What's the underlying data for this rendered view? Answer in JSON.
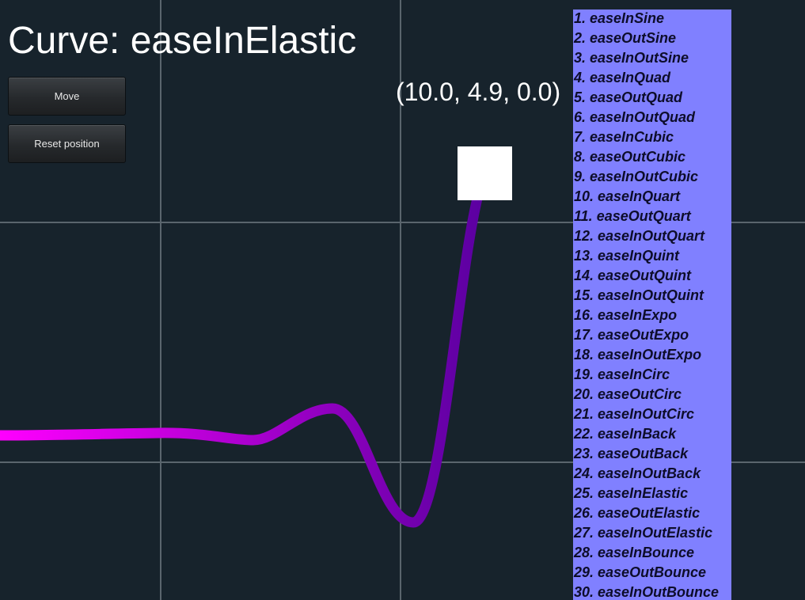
{
  "title": "Curve: easeInElastic",
  "buttons": {
    "move_label": "Move",
    "reset_label": "Reset position"
  },
  "position_readout": "(10.0, 4.9, 0.0)",
  "curve_list": [
    "1. easeInSine",
    "2. easeOutSine",
    "3. easeInOutSine",
    "4. easeInQuad",
    "5. easeOutQuad",
    "6. easeInOutQuad",
    "7. easeInCubic",
    "8. easeOutCubic",
    "9. easeInOutCubic",
    "10. easeInQuart",
    "11. easeOutQuart",
    "12. easeInOutQuart",
    "13. easeInQuint",
    "14. easeOutQuint",
    "15. easeInOutQuint",
    "16. easeInExpo",
    "17. easeOutExpo",
    "18. easeInOutExpo",
    "19. easeInCirc",
    "20. easeOutCirc",
    "21. easeInOutCirc",
    "22. easeInBack",
    "23. easeOutBack",
    "24. easeInOutBack",
    "25. easeInElastic",
    "26. easeOutElastic",
    "27. easeInOutElastic",
    "28. easeInBounce",
    "29. easeOutBounce",
    "30. easeInOutBounce"
  ],
  "colors": {
    "background": "#17232c",
    "grid": "#5a656d",
    "curve_start": "#ff00ff",
    "curve_end": "#5a00a0",
    "list_background": "#8080ff",
    "list_text": "#0d0d2a"
  }
}
